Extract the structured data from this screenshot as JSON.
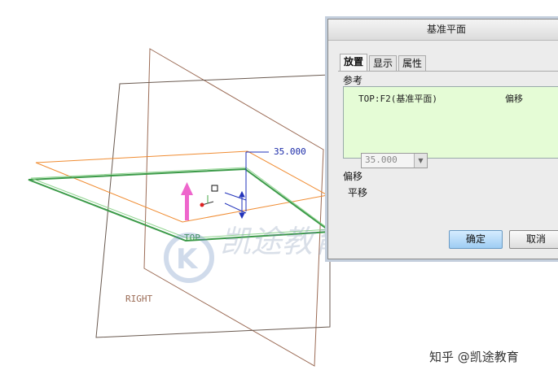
{
  "viewport": {
    "dimension_value": "35.000",
    "plane_labels": {
      "top": "TOP",
      "right": "RIGHT"
    },
    "watermark_text": "凯途教育",
    "colors": {
      "right_plane": "#9b6b55",
      "front_plane": "#6a5a50",
      "offset_plane": "#f08c32",
      "top_plane": "#3b9a48",
      "dimension": "#2233bb",
      "direction_arrow": "#ee66cc"
    }
  },
  "dialog": {
    "title": "基准平面",
    "tabs": [
      {
        "label": "放置",
        "active": true
      },
      {
        "label": "显示",
        "active": false
      },
      {
        "label": "属性",
        "active": false
      }
    ],
    "references_label": "参考",
    "references": [
      {
        "name": "TOP:F2(基准平面)",
        "constraint": "偏移"
      }
    ],
    "offset_section_label": "偏移",
    "translate_label": "平移",
    "translate_value": "35.000",
    "ok_label": "确定",
    "cancel_label": "取消"
  },
  "footer_watermark": "知乎 @凯途教育"
}
